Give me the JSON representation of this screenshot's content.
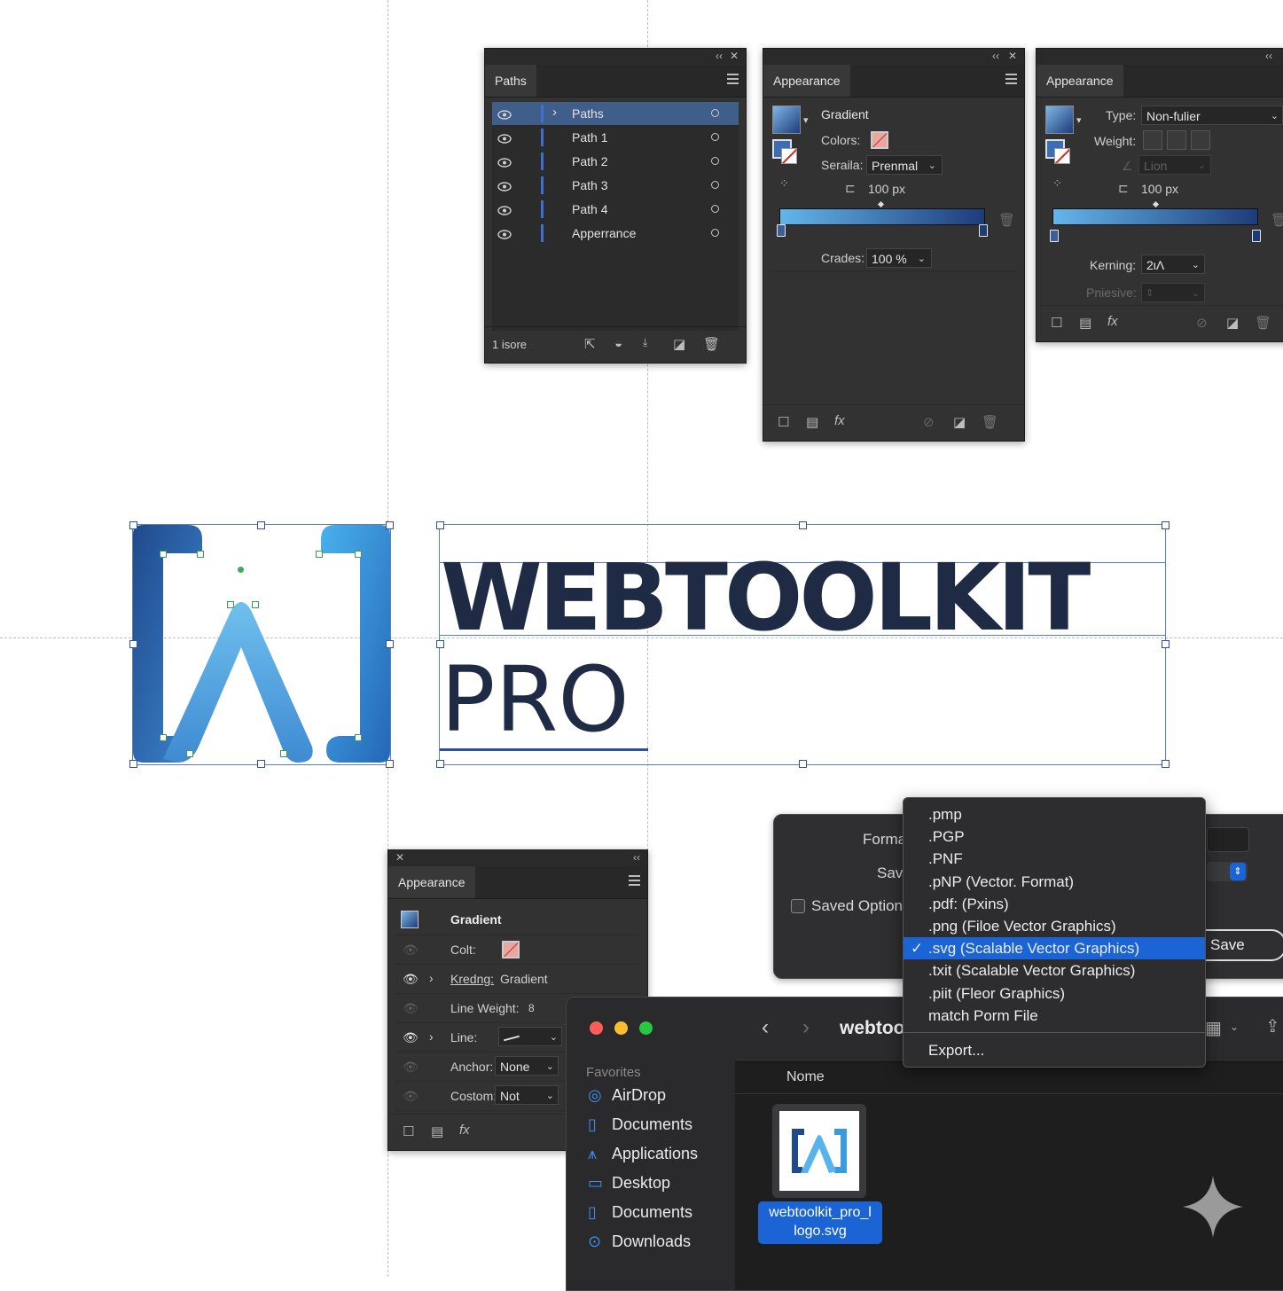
{
  "colors": {
    "panel_bg": "#323232",
    "accent_blue": "#1a64d6",
    "logo_dark": "#1f2a44",
    "logo_light": "#4fb0ea"
  },
  "paths_panel": {
    "tab": "Paths",
    "layers": [
      {
        "name": "Paths",
        "selected": true
      },
      {
        "name": "Path  1"
      },
      {
        "name": "Path  2"
      },
      {
        "name": "Path  3"
      },
      {
        "name": "Path  4"
      },
      {
        "name": "Apperrance"
      }
    ],
    "footer": "1 isore"
  },
  "appearance_panel_1": {
    "tab": "Appearance",
    "fill_label": "Gradient",
    "colors_label": "Colors:",
    "seraila_label": "Seraila:",
    "seraila_value": "Prenmal",
    "size_value": "100 px",
    "crades_label": "Crades:",
    "crades_value": "100 %"
  },
  "appearance_panel_2": {
    "tab": "Appearance",
    "type_label": "Type:",
    "type_value": "Non-fulier",
    "weight_label": "Weight:",
    "lion_value": "Lion",
    "size_value": "100 px",
    "kerning_label": "Kerning:",
    "kerning_value": "2ιΛ",
    "pniesive_label": "Pniesive:"
  },
  "logo": {
    "word1": "WEBTOOLKIT",
    "word2": "PRO"
  },
  "appearance_panel_3": {
    "tab": "Appearance",
    "gradient_label": "Gradient",
    "colt_label": "Colt:",
    "kredng_label": "Kredng:",
    "kredng_value": "Gradient",
    "line_weight_label": "Line Weight:",
    "line_weight_value": "8",
    "line_label": "Line:",
    "anchor_label": "Anchor:",
    "anchor_value": "None",
    "costom_label": "Costom:",
    "costom_value": "Not"
  },
  "export_dialog": {
    "format_label": "Forma",
    "save_label": "Sav",
    "saved_options_label": "Saved Option",
    "save_button": "Save"
  },
  "format_dropdown": {
    "items": [
      ".pmp",
      ".PGP",
      ".PNF",
      ".pNP (Vector. Format)",
      ".pdf&#x200A;: (Pxins)",
      ".png (Filoe Vector Graphics)",
      ".svg (Scalable Vector Graphics)",
      ".txit (Scalable Vector Graphics)",
      ".piit (Fleor Graphics)",
      "match Porm File"
    ],
    "selected_index": 6,
    "export_item": "Export..."
  },
  "finder": {
    "folder_title": "webtoo",
    "favorites_label": "Favorites",
    "sidebar": [
      {
        "label": "AirDrop",
        "icon": "airdrop-icon"
      },
      {
        "label": "Documents",
        "icon": "document-icon"
      },
      {
        "label": "Applications",
        "icon": "applications-icon"
      },
      {
        "label": "Desktop",
        "icon": "desktop-icon"
      },
      {
        "label": "Documents",
        "icon": "document-icon"
      },
      {
        "label": "Downloads",
        "icon": "downloads-icon"
      }
    ],
    "column_name": "Nome",
    "file_name_line1": "webtoolkit_pro_l",
    "file_name_line2": "logo.svg"
  }
}
